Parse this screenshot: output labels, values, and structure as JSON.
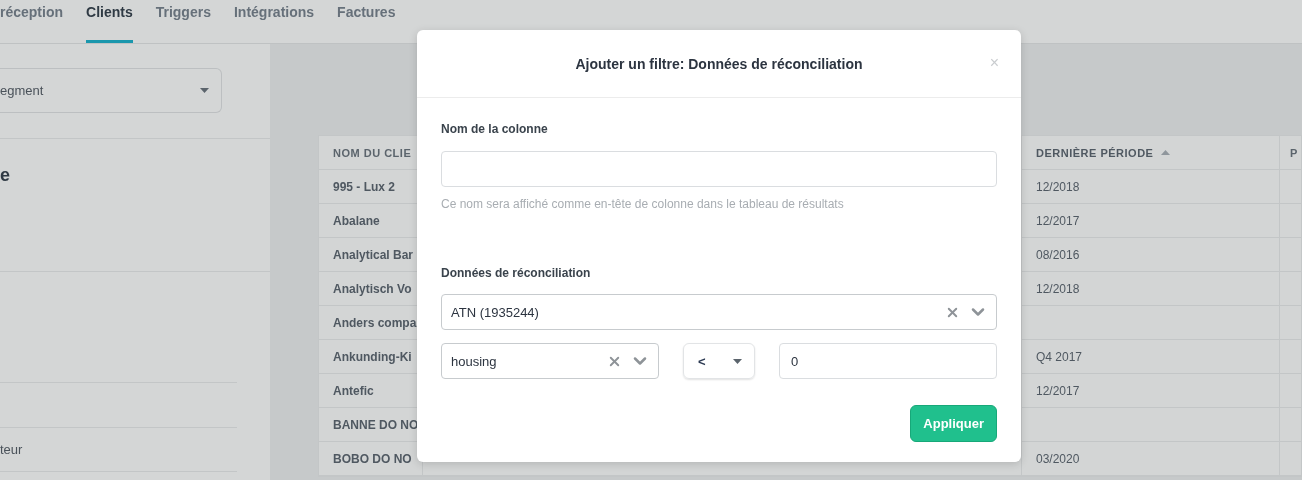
{
  "nav": {
    "tabs": [
      {
        "label": "réception",
        "selected": false
      },
      {
        "label": "Clients",
        "selected": true
      },
      {
        "label": "Triggers",
        "selected": false
      },
      {
        "label": "Intégrations",
        "selected": false
      },
      {
        "label": "Factures",
        "selected": false
      }
    ]
  },
  "sidebar": {
    "segment_select": {
      "value": "egment"
    },
    "heading": "e",
    "item_text": "teur"
  },
  "table": {
    "columns": [
      {
        "label": "NOM DU CLIE",
        "sorted": false
      },
      {
        "label": "DERNIÈRE PÉRIODE",
        "sorted": true
      },
      {
        "label": "P",
        "sorted": false
      }
    ],
    "rows": [
      {
        "name": "995 - Lux 2",
        "period": "12/2018"
      },
      {
        "name": "Abalane",
        "period": "12/2017"
      },
      {
        "name": "Analytical Bar",
        "period": "08/2016"
      },
      {
        "name": "Analytisch Vo",
        "period": "12/2018"
      },
      {
        "name": "Anders compa",
        "period": ""
      },
      {
        "name": "Ankunding-Ki",
        "period": "Q4 2017"
      },
      {
        "name": "Antefic",
        "period": "12/2017"
      },
      {
        "name": "BANNE DO NO",
        "period": ""
      },
      {
        "name": "BOBO DO NO",
        "period": "03/2020"
      }
    ]
  },
  "modal": {
    "title": "Ajouter un filtre: Données de réconciliation",
    "close": "×",
    "column_name": {
      "label": "Nom de la colonne",
      "help": "Ce nom sera affiché comme en-tête de colonne dans le tableau de résultats"
    },
    "reconciliation": {
      "label": "Données de réconciliation",
      "source": "ATN (1935244)",
      "field": "housing",
      "operator": "<",
      "value": "0"
    },
    "apply_button": "Appliquer"
  }
}
